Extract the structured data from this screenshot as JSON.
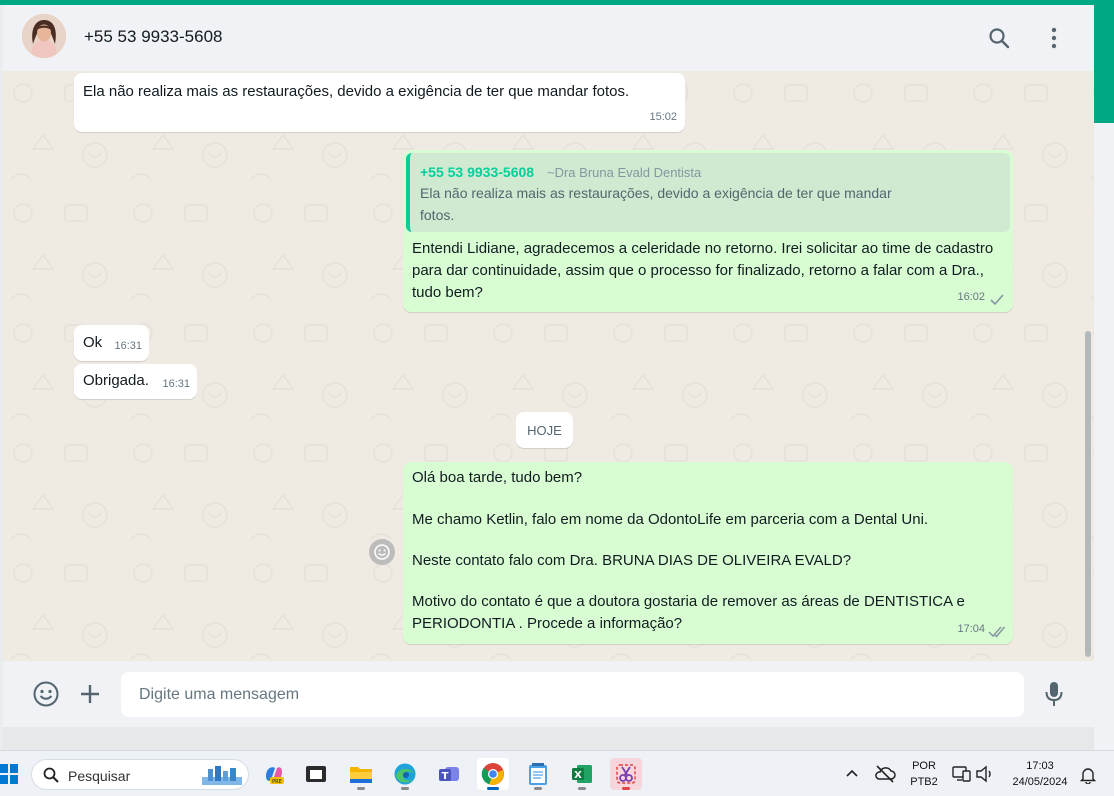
{
  "contact": {
    "name": "+55 53 9933-5608"
  },
  "messages": [
    {
      "direction": "in",
      "text": "Ela não realiza mais as restaurações,  devido a exigência de ter que mandar fotos.",
      "time": "15:02"
    },
    {
      "direction": "out",
      "quote": {
        "name": "+55 53 9933-5608",
        "alias": "~Dra Bruna Evald Dentista",
        "text": "Ela não realiza mais as restaurações,  devido a exigência de ter que mandar fotos."
      },
      "text": "Entendi Lidiane, agradecemos a celeridade no retorno. Irei solicitar ao time de cadastro para dar continuidade, assim que o processo for finalizado, retorno a falar com a Dra., tudo bem?",
      "time": "16:02",
      "status": "sent"
    },
    {
      "direction": "in",
      "text": "Ok",
      "time": "16:31"
    },
    {
      "direction": "in",
      "text": "Obrigada.",
      "time": "16:31"
    },
    {
      "direction": "out",
      "paragraphs": [
        "Olá boa tarde, tudo bem?",
        "Me chamo Ketlin, falo em nome da OdontoLife em parceria com a Dental Uni.",
        "Neste contato falo com Dra. BRUNA DIAS DE OLIVEIRA EVALD?",
        "Motivo do contato é que a doutora gostaria de remover as áreas de DENTISTICA e PERIODONTIA . Procede a informação?"
      ],
      "time": "17:04",
      "status": "delivered"
    }
  ],
  "date_divider": "HOJE",
  "composer": {
    "placeholder": "Digite uma mensagem"
  },
  "icons": {
    "header": [
      "search-icon",
      "menu-icon"
    ],
    "composer": [
      "emoji-icon",
      "plus-icon",
      "mic-icon"
    ]
  },
  "taskbar": {
    "search_label": "Pesquisar",
    "apps": [
      "copilot-icon",
      "terminal-icon",
      "file-explorer-icon",
      "edge-icon",
      "teams-icon",
      "chrome-icon",
      "notepad-icon",
      "excel-icon",
      "snipping-tool-icon"
    ],
    "keyboard_lang": "POR",
    "keyboard_layout": "PTB2",
    "time": "17:03",
    "date": "24/05/2024"
  },
  "colors": {
    "accent": "#00a884",
    "outgoing_bubble": "#d9fdd3",
    "incoming_bubble": "#ffffff",
    "chat_background": "#efeae2",
    "quote_name": "#06cf9c",
    "read_tick": "#8696a0"
  }
}
